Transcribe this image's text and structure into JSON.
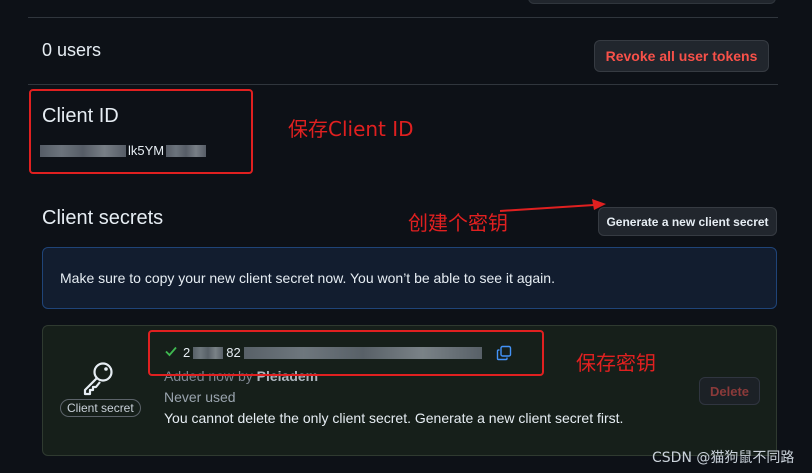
{
  "users": {
    "count_label": "0 users",
    "revoke_label": "Revoke all user tokens"
  },
  "client_id": {
    "label": "Client ID",
    "value_visible": "lk5YM"
  },
  "client_secrets": {
    "title": "Client secrets",
    "generate_label": "Generate a new client secret",
    "flash_message": "Make sure to copy your new client secret now. You won’t be able to see it again.",
    "secret": {
      "badge": "Client secret",
      "value_visible_start": "2",
      "value_visible_mid": "82",
      "added_by_prefix": "Added now by",
      "added_by_user": "Pleiadem",
      "usage": "Never used",
      "warning": "You cannot delete the only client secret. Generate a new client secret first.",
      "delete_label": "Delete"
    }
  },
  "annotations": {
    "save_client_id": "保存Client ID",
    "create_secret": "创建个密钥",
    "save_secret": "保存密钥"
  },
  "watermark": "CSDN @猫狗鼠不同路",
  "colors": {
    "annotation_red": "#e02020",
    "danger": "#f85149",
    "success": "#3fb950",
    "link": "#4493f8"
  },
  "icons": [
    "key-icon",
    "check-icon",
    "copy-icon"
  ]
}
